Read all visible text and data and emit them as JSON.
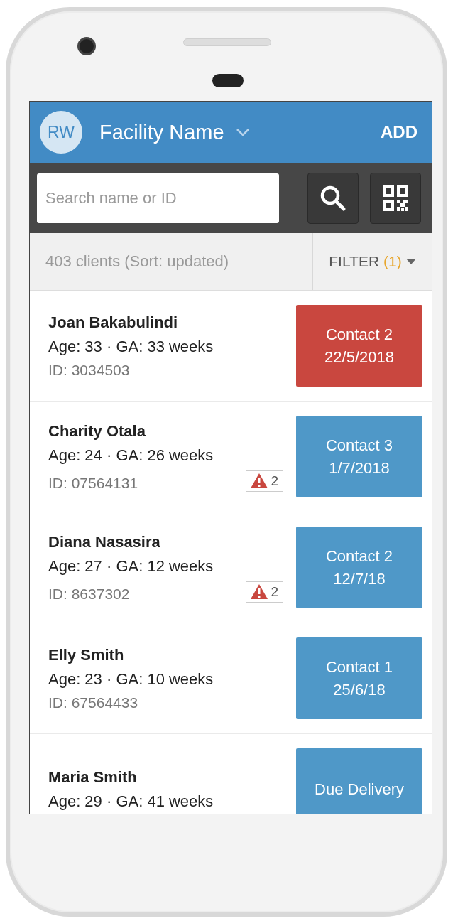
{
  "header": {
    "avatar": "RW",
    "title": "Facility Name",
    "action": "ADD"
  },
  "search": {
    "placeholder": "Search name or ID"
  },
  "summary": {
    "count": "403 clients (Sort: updated)",
    "filter": "FILTER",
    "filter_count": "(1)"
  },
  "clients": [
    {
      "name": "Joan Bakabulindi",
      "details": "Age: 33 · GA: 33 weeks",
      "id": "ID: 3034503",
      "contact": [
        "Contact 2",
        "22/5/2018"
      ],
      "kind": "overdue"
    },
    {
      "name": "Charity Otala",
      "details": "Age: 24 · GA: 26 weeks",
      "id": "ID: 07564131",
      "alerts": "2",
      "contact": [
        "Contact 3",
        "1/7/2018"
      ],
      "kind": "upcoming"
    },
    {
      "name": "Diana Nasasira",
      "details": "Age: 27 · GA: 12 weeks",
      "id": "ID: 8637302",
      "alerts": "2",
      "contact": [
        "Contact 2",
        "12/7/18"
      ],
      "kind": "upcoming"
    },
    {
      "name": "Elly Smith",
      "details": "Age: 23 · GA: 10 weeks",
      "id": "ID: 67564433",
      "contact": [
        "Contact 1",
        "25/6/18"
      ],
      "kind": "upcoming"
    },
    {
      "name": "Maria Smith",
      "details": "Age: 29 · GA: 41 weeks",
      "contact": [
        "Due Delivery"
      ],
      "kind": "upcoming"
    }
  ]
}
